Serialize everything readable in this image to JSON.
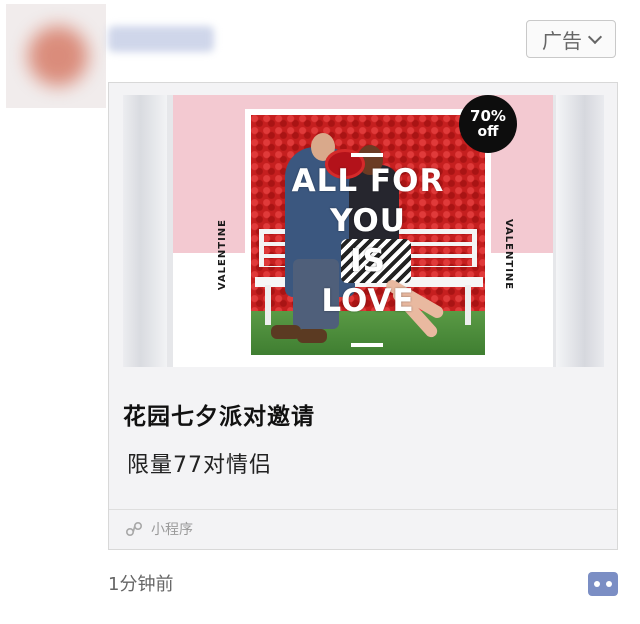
{
  "header": {
    "ad_label": "广告"
  },
  "ad": {
    "poster": {
      "badge_percent": "70%",
      "badge_off": "off",
      "headline_lines": [
        "ALL FOR",
        "YOU",
        "IS",
        "LOVE"
      ],
      "side_text_left": "VALENTINE",
      "side_text_right": "VALENTINE"
    },
    "title": "花园七夕派对邀请",
    "subtitle": "限量77对情侣",
    "source_label": "小程序"
  },
  "footer": {
    "time": "1分钟前"
  },
  "icons": [
    "chevron-down-icon",
    "mini-program-icon",
    "more-icon"
  ],
  "colors": {
    "poster_pink": "#f3c9d1",
    "badge_black": "#0d0d0d",
    "more_button": "#7b8ec4"
  }
}
